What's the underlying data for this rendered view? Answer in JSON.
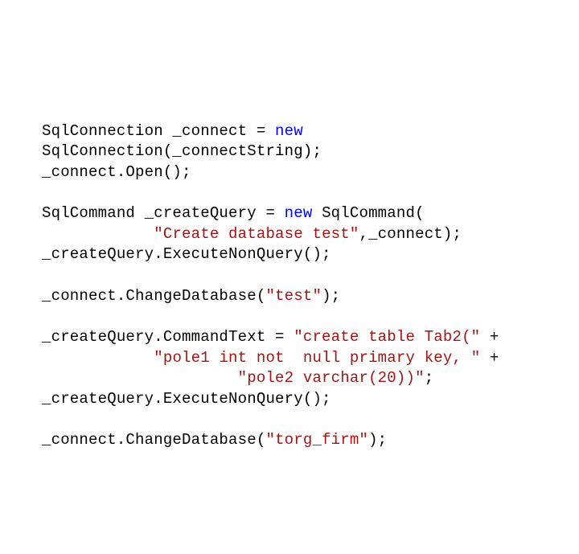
{
  "code": {
    "line1_a": "SqlConnection _connect = ",
    "line1_kw": "new",
    "line2": "SqlConnection(_connectString);",
    "line3": "_connect.Open();",
    "line4": "",
    "line5_a": "SqlCommand _createQuery = ",
    "line5_kw": "new",
    "line5_b": " SqlCommand(",
    "line6_indent": "            ",
    "line6_str": "\"Create database test\"",
    "line6_b": ",_connect);",
    "line7": "_createQuery.ExecuteNonQuery();",
    "line8": "",
    "line9_a": "_connect.ChangeDatabase(",
    "line9_str": "\"test\"",
    "line9_b": ");",
    "line10": "",
    "line11_a": "_createQuery.CommandText = ",
    "line11_str": "\"create table Tab2(\"",
    "line11_b": " +",
    "line12_indent": "            ",
    "line12_str": "\"pole1 int not  null primary key, \"",
    "line12_b": " +",
    "line13_indent": "                     ",
    "line13_str": "\"pole2 varchar(20))\"",
    "line13_b": ";",
    "line14": "_createQuery.ExecuteNonQuery();",
    "line15": "",
    "line16_a": "_connect.ChangeDatabase(",
    "line16_str": "\"torg_firm\"",
    "line16_b": ");"
  }
}
